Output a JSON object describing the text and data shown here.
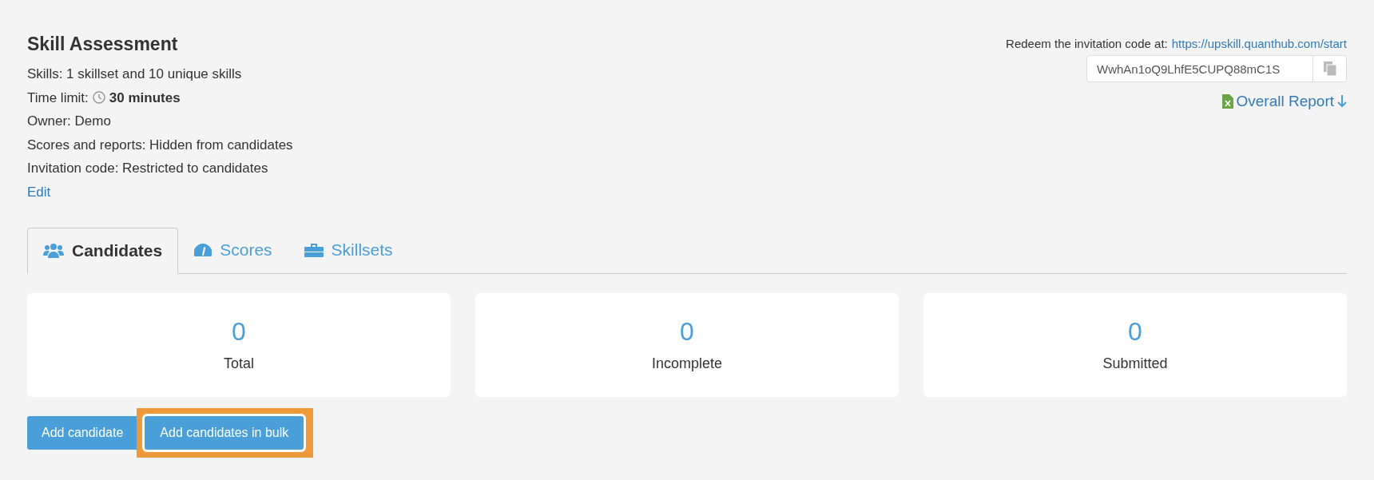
{
  "title": "Skill Assessment",
  "details": [
    {
      "kind": "text",
      "text": "Skills: 1 skillset and 10 unique skills"
    },
    {
      "kind": "time",
      "label": "Time limit:",
      "value": "30 minutes"
    },
    {
      "kind": "text",
      "text": "Owner: Demo"
    },
    {
      "kind": "text",
      "text": "Scores and reports: Hidden from candidates"
    },
    {
      "kind": "text",
      "text": "Invitation code: Restricted to candidates"
    }
  ],
  "edit_link": "Edit",
  "invitation": {
    "label": "Redeem the invitation code at:",
    "url": "https://upskill.quanthub.com/start",
    "code": "WwhAn1oQ9LhfE5CUPQ88mC1S"
  },
  "report_link": "Overall Report",
  "tabs": [
    {
      "kind": "people",
      "label": "Candidates",
      "selected": true
    },
    {
      "kind": "gauge",
      "label": "Scores",
      "selected": false
    },
    {
      "kind": "toolbox",
      "label": "Skillsets",
      "selected": false
    }
  ],
  "stats": [
    {
      "value": "0",
      "label": "Total"
    },
    {
      "value": "0",
      "label": "Incomplete"
    },
    {
      "value": "0",
      "label": "Submitted"
    }
  ],
  "buttons": [
    {
      "label": "Add candidate",
      "highlighted": false
    },
    {
      "label": "Add candidates in bulk",
      "highlighted": true
    }
  ]
}
